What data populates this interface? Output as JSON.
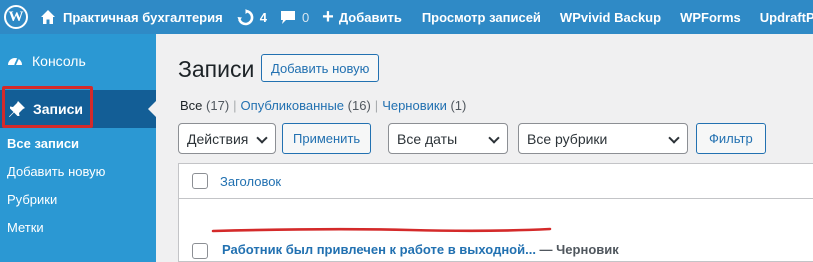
{
  "adminbar": {
    "site_name": "Практичная бухгалтерия",
    "updates_count": "4",
    "comments_count": "0",
    "new_label": "Добавить",
    "links": [
      "Просмотр записей",
      "WPvivid Backup",
      "WPForms",
      "UpdraftPlus"
    ]
  },
  "sidebar": {
    "dashboard_label": "Консоль",
    "posts_label": "Записи",
    "submenu": [
      "Все записи",
      "Добавить новую",
      "Рубрики",
      "Метки"
    ]
  },
  "page": {
    "title": "Записи",
    "add_new_label": "Добавить новую"
  },
  "views": {
    "all_label": "Все",
    "all_count": "(17)",
    "published_label": "Опубликованные",
    "published_count": "(16)",
    "drafts_label": "Черновики",
    "drafts_count": "(1)"
  },
  "filters": {
    "bulk_actions": "Действия",
    "apply_label": "Применить",
    "dates": "Все даты",
    "categories": "Все рубрики",
    "filter_label": "Фильтр"
  },
  "table": {
    "column_title": "Заголовок",
    "rows": [
      {
        "title": "Работник был привлечен к работе в выходной...",
        "state": " — Черновик"
      }
    ]
  },
  "colors": {
    "adminbar_bg": "#2f8ac6",
    "sidebar_bg": "#2b98d3",
    "sidebar_active_bg": "#135e96",
    "link": "#2271b1",
    "highlight_red": "#d42a2a"
  },
  "icons": [
    "wordpress-logo-icon",
    "home-icon",
    "updates-icon",
    "comments-icon",
    "plus-icon",
    "dashboard-icon",
    "pin-icon"
  ]
}
